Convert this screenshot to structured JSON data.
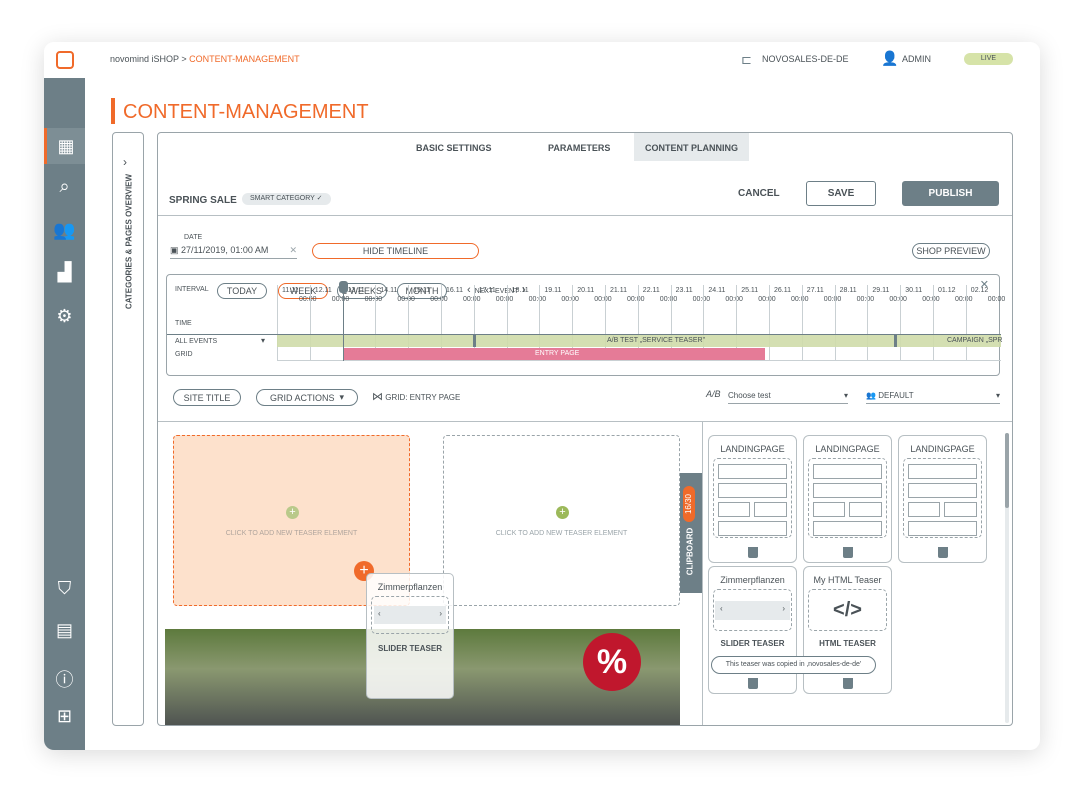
{
  "topbar": {
    "brand": "novomind iSHOP",
    "separator": ">",
    "section": "CONTENT-MANAGEMENT",
    "shop": "NOVOSALES-DE-DE",
    "user": "ADMIN",
    "status": "LIVE"
  },
  "sidebar": {
    "items": [
      "dashboard-icon",
      "search-icon",
      "users-icon",
      "chart-icon",
      "settings-icon"
    ],
    "bottom": [
      "shield-icon",
      "document-icon",
      "help-icon",
      "apps-icon"
    ]
  },
  "page": {
    "title": "CONTENT-MANAGEMENT",
    "side_panel": "CATEGORIES & PAGES OVERVIEW"
  },
  "tabs": [
    {
      "label": "BASIC SETTINGS"
    },
    {
      "label": "PARAMETERS"
    },
    {
      "label": "CONTENT PLANNING",
      "active": true
    }
  ],
  "header": {
    "name": "SPRING SALE",
    "badge": "SMART CATEGORY",
    "cancel": "CANCEL",
    "save": "SAVE",
    "publish": "PUBLISH"
  },
  "date": {
    "label": "DATE",
    "value": "27/11/2019, 01:00 AM",
    "hide_timeline": "HIDE TIMELINE",
    "shop_preview": "SHOP PREVIEW"
  },
  "timeline": {
    "interval_label": "INTERVAL",
    "intervals": [
      "TODAY",
      "WEEK",
      "2 WEEKS",
      "MONTH"
    ],
    "active_interval": "WEEK",
    "next_event": "NEXT EVENT",
    "rows": [
      "TIME",
      "ALL EVENTS",
      "GRID"
    ],
    "days": [
      "11.11",
      "12.11",
      "13.11",
      "14.11",
      "15.11",
      "16.11",
      "17.11",
      "18.11",
      "19.11",
      "20.11",
      "21.11",
      "22.11",
      "23.11",
      "24.11",
      "25.11",
      "26.11",
      "27.11",
      "28.11",
      "29.11",
      "30.11",
      "01.12",
      "02.12"
    ],
    "time": "00:00",
    "event1": "A/B TEST „SERVICE TEASER\"",
    "event2": "CAMPAIGN „SPR",
    "grid_event": "ENTRY PAGE",
    "colors": {
      "events": "#cfdcaa",
      "grid": "#e57b97"
    }
  },
  "toolbar": {
    "site_title": "SITE TITLE",
    "grid_actions": "GRID ACTIONS",
    "grid": "GRID: ENTRY PAGE",
    "ab_test": "Choose test",
    "segment": "DEFAULT"
  },
  "canvas": {
    "add_text": "CLICK TO ADD NEW TEASER ELEMENT",
    "drag_title": "Zimmerpflanzen",
    "drag_type": "SLIDER TEASER",
    "sale_badge": "%"
  },
  "clipboard": {
    "label": "CLIPBOARD",
    "count": "16/30",
    "items": [
      {
        "title": "LANDINGPAGE"
      },
      {
        "title": "LANDINGPAGE"
      },
      {
        "title": "LANDINGPAGE"
      },
      {
        "title": "Zimmerpflanzen",
        "type": "SLIDER TEASER"
      },
      {
        "title": "My HTML Teaser",
        "type": "HTML TEASER",
        "icon": "</>"
      }
    ],
    "tooltip": "This teaser was copied in ‚novosales-de-de'"
  }
}
